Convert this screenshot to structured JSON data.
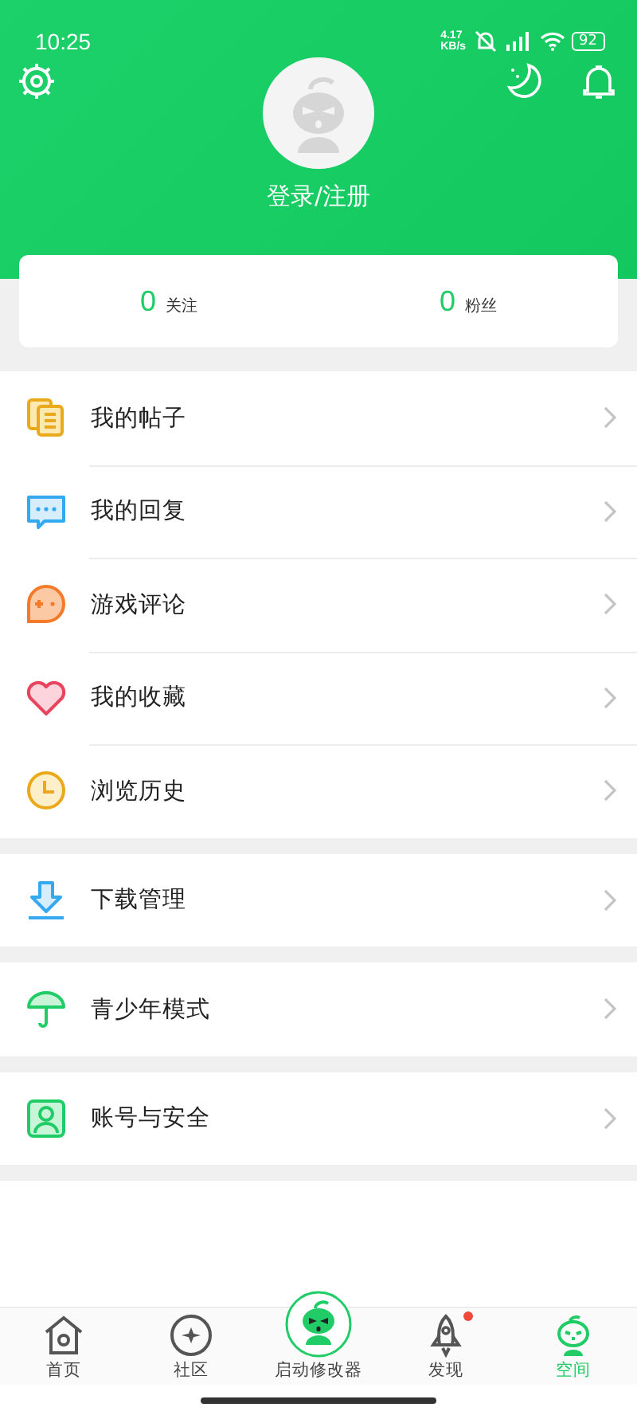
{
  "status_bar": {
    "time": "10:25",
    "speed": "4.17",
    "speed_unit": "KB/s",
    "battery": "92"
  },
  "header": {
    "login": "登录/注册"
  },
  "stats": [
    {
      "count": "0",
      "label": "关注"
    },
    {
      "count": "0",
      "label": "粉丝"
    }
  ],
  "menu_groups": [
    {
      "items": [
        {
          "kind": "posts",
          "label": "我的帖子"
        },
        {
          "kind": "replies",
          "label": "我的回复"
        },
        {
          "kind": "reviews",
          "label": "游戏评论"
        },
        {
          "kind": "favorites",
          "label": "我的收藏"
        },
        {
          "kind": "history",
          "label": "浏览历史"
        }
      ]
    },
    {
      "items": [
        {
          "kind": "download",
          "label": "下载管理"
        }
      ]
    },
    {
      "items": [
        {
          "kind": "youth",
          "label": "青少年模式"
        }
      ]
    },
    {
      "items": [
        {
          "kind": "account",
          "label": "账号与安全"
        }
      ]
    }
  ],
  "tab_bar": [
    {
      "kind": "home",
      "label": "首页",
      "selected": false,
      "badge": false
    },
    {
      "kind": "community",
      "label": "社区",
      "selected": false,
      "badge": false
    },
    {
      "kind": "launcher",
      "label": "启动修改器",
      "selected": false,
      "badge": false
    },
    {
      "kind": "discover",
      "label": "发现",
      "selected": false,
      "badge": true
    },
    {
      "kind": "space",
      "label": "空间",
      "selected": true,
      "badge": false
    }
  ]
}
